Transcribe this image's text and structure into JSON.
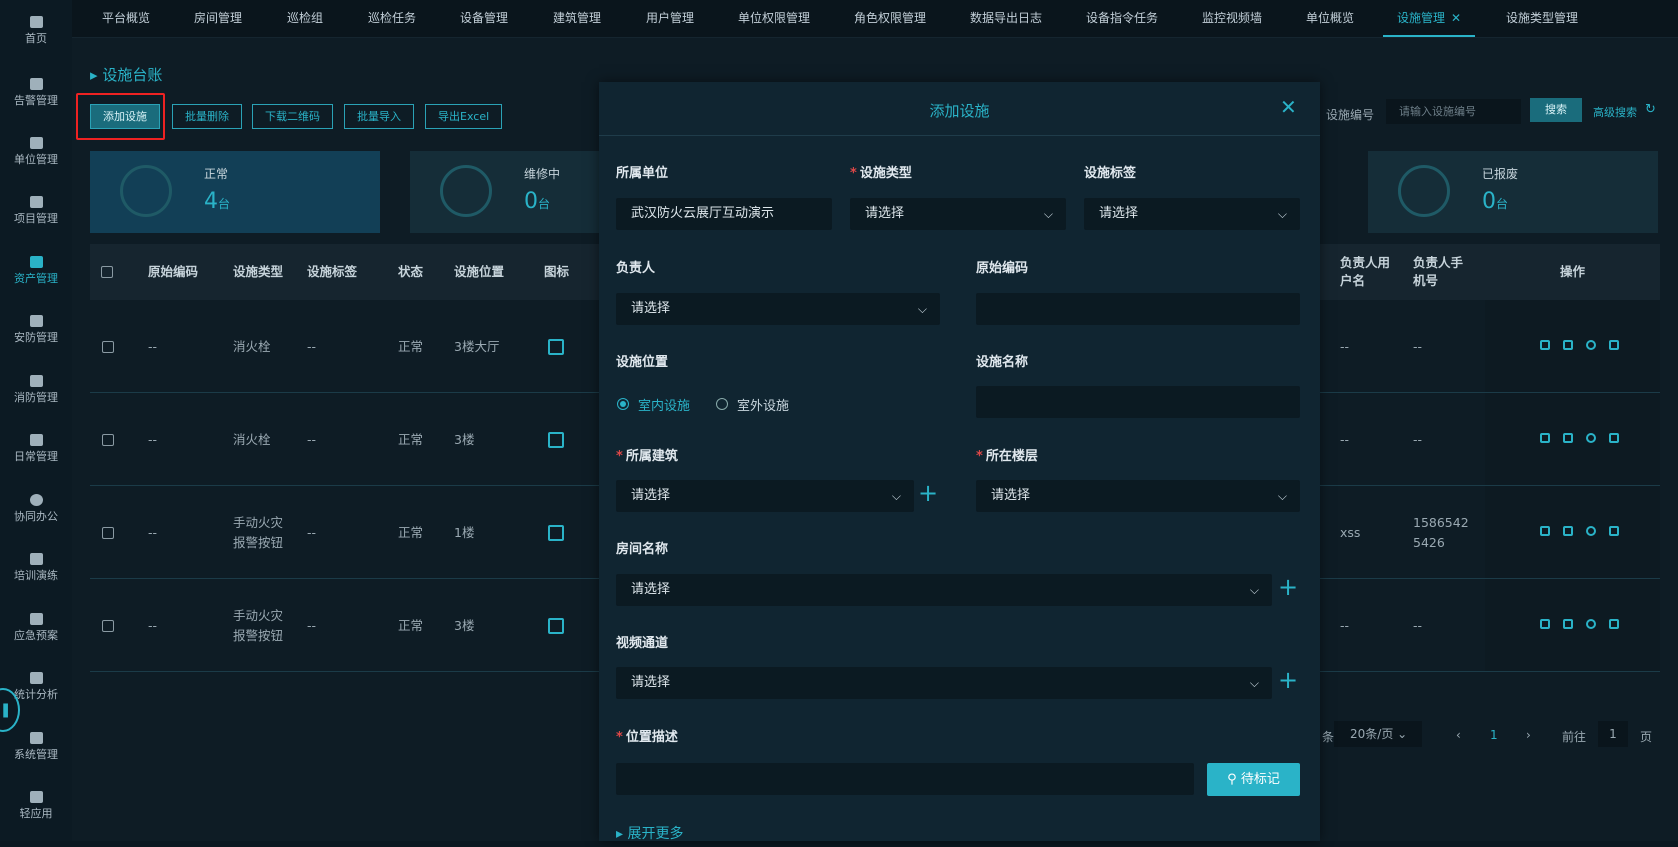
{
  "sidebar": {
    "items": [
      {
        "label": "首页",
        "icon": "home-icon"
      },
      {
        "label": "告警管理",
        "icon": "alarm-icon"
      },
      {
        "label": "单位管理",
        "icon": "building-icon"
      },
      {
        "label": "项目管理",
        "icon": "project-icon"
      },
      {
        "label": "资产管理",
        "icon": "asset-icon"
      },
      {
        "label": "安防管理",
        "icon": "shield-icon"
      },
      {
        "label": "消防管理",
        "icon": "fire-icon"
      },
      {
        "label": "日常管理",
        "icon": "calendar-icon"
      },
      {
        "label": "协同办公",
        "icon": "collab-icon"
      },
      {
        "label": "培训演练",
        "icon": "training-icon"
      },
      {
        "label": "应急预案",
        "icon": "emergency-icon"
      },
      {
        "label": "统计分析",
        "icon": "chart-icon"
      },
      {
        "label": "系统管理",
        "icon": "system-icon"
      },
      {
        "label": "轻应用",
        "icon": "apps-icon"
      }
    ],
    "active": "资产管理"
  },
  "tabs": [
    "平台概览",
    "房间管理",
    "巡检组",
    "巡检任务",
    "设备管理",
    "建筑管理",
    "用户管理",
    "单位权限管理",
    "角色权限管理",
    "数据导出日志",
    "设备指令任务",
    "监控视频墙",
    "单位概览",
    "设施管理",
    "设施类型管理"
  ],
  "active_tab": "设施管理",
  "page": {
    "title": "设施台账",
    "buttons": {
      "add": "添加设施",
      "batch_delete": "批量删除",
      "download_qr": "下载二维码",
      "batch_import": "批量导入",
      "export": "导出Excel"
    },
    "search": {
      "label": "设施编号",
      "placeholder": "请输入设施编号",
      "button": "搜索",
      "advanced": "高级搜索"
    }
  },
  "cards": [
    {
      "title": "正常",
      "value": "4",
      "unit": "台"
    },
    {
      "title": "维修中",
      "value": "0",
      "unit": "台"
    },
    {
      "title": "已报废",
      "value": "0",
      "unit": "台"
    }
  ],
  "table": {
    "headers": [
      "原始编码",
      "设施类型",
      "设施标签",
      "状态",
      "设施位置",
      "图标",
      "负责人用户名",
      "负责人手机号",
      "操作"
    ],
    "rows": [
      {
        "code": "--",
        "type": "消火栓",
        "tag": "--",
        "status": "正常",
        "location": "3楼大厅",
        "user": "--",
        "phone": "--"
      },
      {
        "code": "--",
        "type": "消火栓",
        "tag": "--",
        "status": "正常",
        "location": "3楼",
        "user": "--",
        "phone": "--"
      },
      {
        "code": "--",
        "type": "手动火灾报警按钮",
        "tag": "--",
        "status": "正常",
        "location": "1楼",
        "user": "xss",
        "phone": "15865425426"
      },
      {
        "code": "--",
        "type": "手动火灾报警按钮",
        "tag": "--",
        "status": "正常",
        "location": "3楼",
        "user": "--",
        "phone": "--"
      }
    ]
  },
  "pager": {
    "page_size": "20条/页",
    "current": "1",
    "goto_prefix": "前往",
    "goto_value": "1",
    "goto_suffix": "页",
    "total_suffix": "条"
  },
  "modal": {
    "title": "添加设施",
    "fields": {
      "unit": {
        "label": "所属单位",
        "value": "武汉防火云展厅互动演示"
      },
      "type": {
        "label": "设施类型",
        "value": "请选择"
      },
      "tag": {
        "label": "设施标签",
        "value": "请选择"
      },
      "owner": {
        "label": "负责人",
        "value": "请选择"
      },
      "orig_code": {
        "label": "原始编码",
        "value": ""
      },
      "location": {
        "label": "设施位置",
        "options": [
          "室内设施",
          "室外设施"
        ],
        "selected": "室内设施"
      },
      "name": {
        "label": "设施名称",
        "value": ""
      },
      "building": {
        "label": "所属建筑",
        "value": "请选择"
      },
      "floor": {
        "label": "所在楼层",
        "value": "请选择"
      },
      "room": {
        "label": "房间名称",
        "value": "请选择"
      },
      "video": {
        "label": "视频通道",
        "value": "请选择"
      },
      "position_desc": {
        "label": "位置描述",
        "value": ""
      }
    },
    "mark_button": "待标记",
    "expand": "展开更多"
  },
  "colors": {
    "accent": "#2ab3c8",
    "background": "#0e1c25",
    "modal": "#102531",
    "required": "#e04848"
  }
}
